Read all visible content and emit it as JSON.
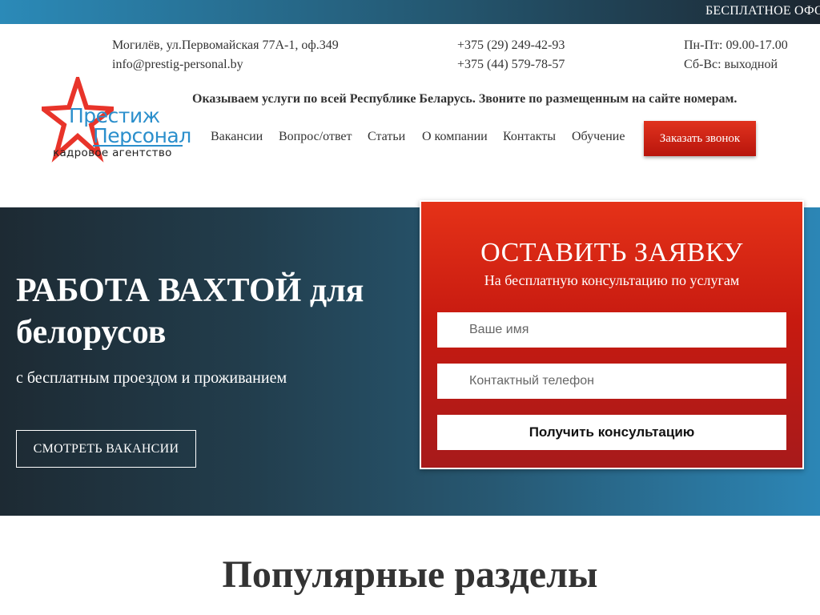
{
  "top_strip": {
    "marquee": "БЕСПЛАТНОЕ ОФО"
  },
  "contacts": {
    "address": "Могилёв, ул.Первомайская 77А-1, оф.349",
    "email": "info@prestig-personal.by",
    "phone_1": "+375 (29) 249-42-93",
    "phone_2": "+375 (44) 579-78-57",
    "hours_weekdays": "Пн-Пт: 09.00-17.00",
    "hours_weekend": "Сб-Вс: выходной"
  },
  "logo": {
    "line1": "Престиж",
    "line2": "Персонал",
    "line3": "кадровое агентство",
    "star_color": "#e8342a",
    "text_color": "#2b8fcc"
  },
  "tagline": "Оказываем услуги по всей Республике Беларусь. Звоните по размещенным на сайте номерам.",
  "nav": {
    "items": [
      {
        "label": "Вакансии"
      },
      {
        "label": "Вопрос/ответ"
      },
      {
        "label": "Статьи"
      },
      {
        "label": "О компании"
      },
      {
        "label": "Контакты"
      },
      {
        "label": "Обучение"
      }
    ],
    "callback_button": "Заказать звонок"
  },
  "hero": {
    "title_bold": "РАБОТА ВАХТОЙ",
    "title_rest": "для белорусов",
    "subtitle": "с бесплатным проездом и проживанием",
    "button": "СМОТРЕТЬ ВАКАНСИИ"
  },
  "form": {
    "title": "ОСТАВИТЬ ЗАЯВКУ",
    "subtitle": "На бесплатную консультацию по услугам",
    "name_placeholder": "Ваше имя",
    "phone_placeholder": "Контактный телефон",
    "submit": "Получить консультацию",
    "accent_color": "#d42516"
  },
  "popular": {
    "title": "Популярные разделы"
  }
}
